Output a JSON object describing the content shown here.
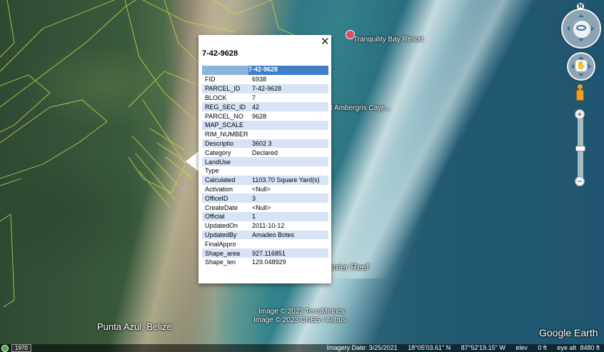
{
  "map": {
    "labels": {
      "resort": "Tranquility Bay Resort",
      "ambergris": "t Ambergris Caye...",
      "reef": "arrier Reef",
      "punta_azul": "Punta Azul, Belize",
      "credit1": "Image © 2023 TerraMetrics",
      "credit2": "Image © 2023 CNES / Airbus",
      "brand": "Google Earth"
    }
  },
  "status": {
    "history_year": "1970",
    "imagery_date": "Imagery Date: 3/25/2021",
    "lat": "18°05'03.61\" N",
    "lon": "87°52'19.15\" W",
    "elev": "elev",
    "elev_val": "0 ft",
    "eye_alt_label": "eye alt",
    "eye_alt": "8480 ft"
  },
  "nav": {
    "north": "N",
    "zoom_in": "+",
    "zoom_out": "−",
    "move_icon": "hand-icon"
  },
  "popup": {
    "title": "7-42-9628",
    "close": "✕",
    "table_header": "7-42-9628",
    "rows": [
      {
        "k": "FID",
        "v": "6938"
      },
      {
        "k": "PARCEL_ID",
        "v": "7-42-9628"
      },
      {
        "k": "BLOCK",
        "v": "7"
      },
      {
        "k": "REG_SEC_ID",
        "v": "42"
      },
      {
        "k": "PARCEL_NO",
        "v": "9628"
      },
      {
        "k": "MAP_SCALE",
        "v": ""
      },
      {
        "k": "RIM_NUMBER",
        "v": ""
      },
      {
        "k": "Descriptio",
        "v": "3602 3"
      },
      {
        "k": "Category",
        "v": "Declared"
      },
      {
        "k": "LandUse",
        "v": ""
      },
      {
        "k": "Type",
        "v": ""
      },
      {
        "k": "Calculated",
        "v": "1103.70 Square Yard(s)"
      },
      {
        "k": "Activation",
        "v": "<Null>"
      },
      {
        "k": "OfficeID",
        "v": "3"
      },
      {
        "k": "CreateDate",
        "v": "<Null>"
      },
      {
        "k": "Official",
        "v": "1"
      },
      {
        "k": "UpdatedOn",
        "v": "2011-10-12"
      },
      {
        "k": "UpdatedBy",
        "v": "Amadeo Botes"
      },
      {
        "k": "FinalAppro",
        "v": ""
      },
      {
        "k": "Shape_area",
        "v": "927.116851"
      },
      {
        "k": "Shape_len",
        "v": "129.048929"
      }
    ]
  }
}
